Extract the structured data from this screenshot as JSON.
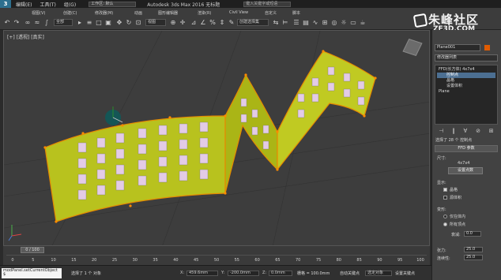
{
  "titlebar": {
    "menus": [
      "3(E)",
      "编辑(E)",
      "工具(T)",
      "组(G)",
      "视图(V)",
      "创建(C)",
      "修改器(M)",
      "动画",
      "图形编辑器",
      "渲染(R)",
      "Civil View",
      "自定义",
      "脚本"
    ],
    "workspace": "工作区: 默认",
    "title": "Autodesk 3ds Max 2016    无标题",
    "search_placeholder": "键入关键字或短语"
  },
  "toolbar": {
    "selection_set": "全部",
    "view_dropdown": "视图",
    "create_selection_set": "创建选择集"
  },
  "viewport": {
    "label": "[+] [透视] [真实]"
  },
  "logo": {
    "line1": "朱峰社区",
    "line2": "ZF3D.COM"
  },
  "command_panel": {
    "object_name": "Plane001",
    "modifier_list": "修改器列表",
    "stack": [
      {
        "label": "FFD(长方体) 4x7x4",
        "selected": false,
        "indent": false
      },
      {
        "label": "控制点",
        "selected": true,
        "indent": true
      },
      {
        "label": "晶格",
        "selected": false,
        "indent": true
      },
      {
        "label": "设置体积",
        "selected": false,
        "indent": true
      },
      {
        "label": "Plane",
        "selected": false,
        "indent": false
      }
    ],
    "stack_tools": [
      "⊣",
      "‖",
      "∀",
      "⊘",
      "⊞"
    ],
    "status_text": "选择了 28 个 控制点",
    "rollout_title": "FFD 参数",
    "dimensions_label": "尺寸:",
    "dimensions_value": "4x7x4",
    "set_points_button": "设置点数",
    "display_label": "显示:",
    "lattice_label": "晶格",
    "source_volume_label": "源体积",
    "deform_label": "变形:",
    "only_in_volume_label": "仅在体内",
    "all_vertices_label": "所有顶点",
    "falloff_label": "衰减:",
    "falloff_value": "0.0",
    "tension_label": "张力:",
    "tension_value": "25.0",
    "continuity_label": "连续性:",
    "continuity_value": "25.0"
  },
  "timeline": {
    "slider": "0 / 100",
    "ticks": [
      "0",
      "5",
      "10",
      "15",
      "20",
      "25",
      "30",
      "35",
      "40",
      "45",
      "50",
      "55",
      "60",
      "65",
      "70",
      "75",
      "80",
      "85",
      "90",
      "95",
      "100"
    ]
  },
  "statusbar": {
    "script_line1": "modPanel.setCurrentObject $",
    "script_line2": "",
    "message": "选择了 1 个 对象",
    "x_label": "X:",
    "x_value": "459.6mm",
    "y_label": "Y:",
    "y_value": "-200.0mm",
    "z_label": "Z:",
    "z_value": "0.0mm",
    "grid_label": "栅格 = 100.0mm",
    "autokey_label": "自动关键点",
    "selected_label": "选定对象",
    "setkey_label": "设置关键点"
  }
}
